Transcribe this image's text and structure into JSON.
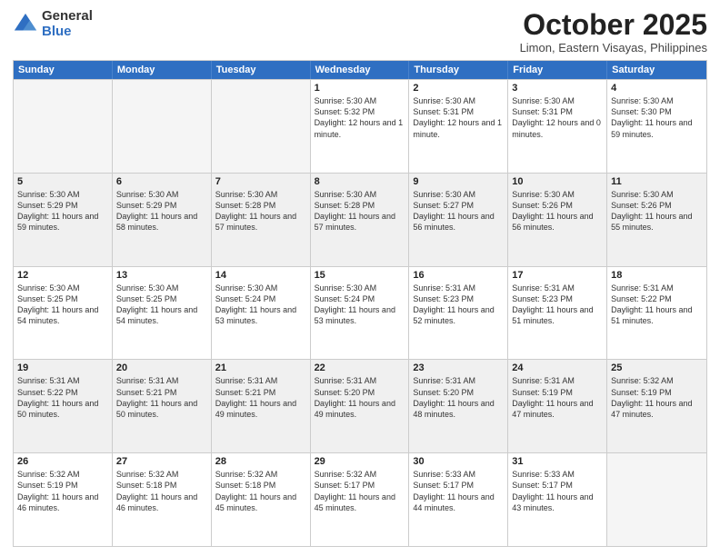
{
  "logo": {
    "general": "General",
    "blue": "Blue"
  },
  "header": {
    "month": "October 2025",
    "location": "Limon, Eastern Visayas, Philippines"
  },
  "days": [
    "Sunday",
    "Monday",
    "Tuesday",
    "Wednesday",
    "Thursday",
    "Friday",
    "Saturday"
  ],
  "rows": [
    [
      {
        "day": "",
        "empty": true
      },
      {
        "day": "",
        "empty": true
      },
      {
        "day": "",
        "empty": true
      },
      {
        "day": "1",
        "sunrise": "5:30 AM",
        "sunset": "5:32 PM",
        "daylight": "12 hours and 1 minute."
      },
      {
        "day": "2",
        "sunrise": "5:30 AM",
        "sunset": "5:31 PM",
        "daylight": "12 hours and 1 minute."
      },
      {
        "day": "3",
        "sunrise": "5:30 AM",
        "sunset": "5:31 PM",
        "daylight": "12 hours and 0 minutes."
      },
      {
        "day": "4",
        "sunrise": "5:30 AM",
        "sunset": "5:30 PM",
        "daylight": "11 hours and 59 minutes."
      }
    ],
    [
      {
        "day": "5",
        "sunrise": "5:30 AM",
        "sunset": "5:29 PM",
        "daylight": "11 hours and 59 minutes."
      },
      {
        "day": "6",
        "sunrise": "5:30 AM",
        "sunset": "5:29 PM",
        "daylight": "11 hours and 58 minutes."
      },
      {
        "day": "7",
        "sunrise": "5:30 AM",
        "sunset": "5:28 PM",
        "daylight": "11 hours and 57 minutes."
      },
      {
        "day": "8",
        "sunrise": "5:30 AM",
        "sunset": "5:28 PM",
        "daylight": "11 hours and 57 minutes."
      },
      {
        "day": "9",
        "sunrise": "5:30 AM",
        "sunset": "5:27 PM",
        "daylight": "11 hours and 56 minutes."
      },
      {
        "day": "10",
        "sunrise": "5:30 AM",
        "sunset": "5:26 PM",
        "daylight": "11 hours and 56 minutes."
      },
      {
        "day": "11",
        "sunrise": "5:30 AM",
        "sunset": "5:26 PM",
        "daylight": "11 hours and 55 minutes."
      }
    ],
    [
      {
        "day": "12",
        "sunrise": "5:30 AM",
        "sunset": "5:25 PM",
        "daylight": "11 hours and 54 minutes."
      },
      {
        "day": "13",
        "sunrise": "5:30 AM",
        "sunset": "5:25 PM",
        "daylight": "11 hours and 54 minutes."
      },
      {
        "day": "14",
        "sunrise": "5:30 AM",
        "sunset": "5:24 PM",
        "daylight": "11 hours and 53 minutes."
      },
      {
        "day": "15",
        "sunrise": "5:30 AM",
        "sunset": "5:24 PM",
        "daylight": "11 hours and 53 minutes."
      },
      {
        "day": "16",
        "sunrise": "5:31 AM",
        "sunset": "5:23 PM",
        "daylight": "11 hours and 52 minutes."
      },
      {
        "day": "17",
        "sunrise": "5:31 AM",
        "sunset": "5:23 PM",
        "daylight": "11 hours and 51 minutes."
      },
      {
        "day": "18",
        "sunrise": "5:31 AM",
        "sunset": "5:22 PM",
        "daylight": "11 hours and 51 minutes."
      }
    ],
    [
      {
        "day": "19",
        "sunrise": "5:31 AM",
        "sunset": "5:22 PM",
        "daylight": "11 hours and 50 minutes."
      },
      {
        "day": "20",
        "sunrise": "5:31 AM",
        "sunset": "5:21 PM",
        "daylight": "11 hours and 50 minutes."
      },
      {
        "day": "21",
        "sunrise": "5:31 AM",
        "sunset": "5:21 PM",
        "daylight": "11 hours and 49 minutes."
      },
      {
        "day": "22",
        "sunrise": "5:31 AM",
        "sunset": "5:20 PM",
        "daylight": "11 hours and 49 minutes."
      },
      {
        "day": "23",
        "sunrise": "5:31 AM",
        "sunset": "5:20 PM",
        "daylight": "11 hours and 48 minutes."
      },
      {
        "day": "24",
        "sunrise": "5:31 AM",
        "sunset": "5:19 PM",
        "daylight": "11 hours and 47 minutes."
      },
      {
        "day": "25",
        "sunrise": "5:32 AM",
        "sunset": "5:19 PM",
        "daylight": "11 hours and 47 minutes."
      }
    ],
    [
      {
        "day": "26",
        "sunrise": "5:32 AM",
        "sunset": "5:19 PM",
        "daylight": "11 hours and 46 minutes."
      },
      {
        "day": "27",
        "sunrise": "5:32 AM",
        "sunset": "5:18 PM",
        "daylight": "11 hours and 46 minutes."
      },
      {
        "day": "28",
        "sunrise": "5:32 AM",
        "sunset": "5:18 PM",
        "daylight": "11 hours and 45 minutes."
      },
      {
        "day": "29",
        "sunrise": "5:32 AM",
        "sunset": "5:17 PM",
        "daylight": "11 hours and 45 minutes."
      },
      {
        "day": "30",
        "sunrise": "5:33 AM",
        "sunset": "5:17 PM",
        "daylight": "11 hours and 44 minutes."
      },
      {
        "day": "31",
        "sunrise": "5:33 AM",
        "sunset": "5:17 PM",
        "daylight": "11 hours and 43 minutes."
      },
      {
        "day": "",
        "empty": true
      }
    ]
  ],
  "labels": {
    "sunrise": "Sunrise:",
    "sunset": "Sunset:",
    "daylight": "Daylight:"
  }
}
